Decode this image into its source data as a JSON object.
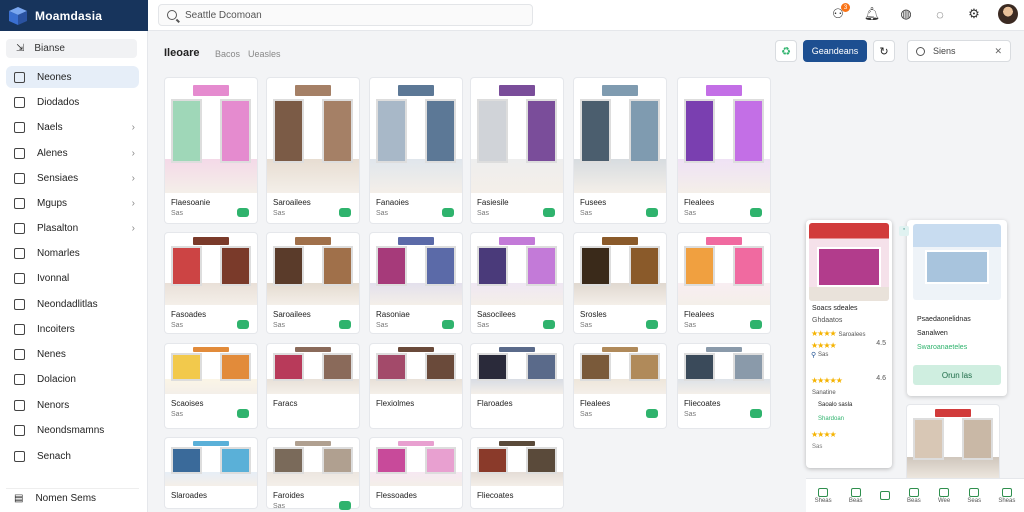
{
  "brand": {
    "name": "Moamdasia"
  },
  "search": {
    "placeholder": "Seattle Dcomoan"
  },
  "header": {
    "badge_count": "3"
  },
  "sidebar": {
    "head": "Bianse",
    "items": [
      {
        "label": "Neones",
        "chev": false
      },
      {
        "label": "Diodados",
        "chev": false
      },
      {
        "label": "Naels",
        "chev": true
      },
      {
        "label": "Alenes",
        "chev": true
      },
      {
        "label": "Sensiaes",
        "chev": true
      },
      {
        "label": "Mgups",
        "chev": true
      },
      {
        "label": "Plasalton",
        "chev": true
      },
      {
        "label": "Nomarles",
        "chev": false
      },
      {
        "label": "Ivonnal",
        "chev": false
      },
      {
        "label": "Neondadlitlas",
        "chev": false
      },
      {
        "label": "Incoiters",
        "chev": false
      },
      {
        "label": "Nenes",
        "chev": false
      },
      {
        "label": "Dolacion",
        "chev": false
      },
      {
        "label": "Nenors",
        "chev": false
      },
      {
        "label": "Neondsmamns",
        "chev": false
      },
      {
        "label": "Senach",
        "chev": false
      }
    ],
    "footer": "Nomen Sems"
  },
  "main": {
    "title": "Ileoare",
    "crumbs": [
      "Bacos",
      "Ueasles"
    ],
    "primary_button": "Geandeans",
    "right_search": "Siens"
  },
  "cards": [
    {
      "title": "Flaesoanie",
      "sub": "Sas"
    },
    {
      "title": "Saroailees",
      "sub": "Sas"
    },
    {
      "title": "Fanaoies",
      "sub": "Sas"
    },
    {
      "title": "Fasiesile",
      "sub": "Sas"
    },
    {
      "title": "Fusees",
      "sub": "Sas"
    },
    {
      "title": "Flealees",
      "sub": "Sas"
    },
    {
      "title": "Fasoades",
      "sub": "Sas"
    },
    {
      "title": "Saroailees",
      "sub": "Sas"
    },
    {
      "title": "Rasoniae",
      "sub": "Sas"
    },
    {
      "title": "Sasocilees",
      "sub": "Sas"
    },
    {
      "title": "Srosles",
      "sub": "Sas"
    },
    {
      "title": "Flealees",
      "sub": "Sas"
    },
    {
      "title": "Scaoises",
      "sub": "Sas"
    },
    {
      "title": "Faracs",
      "sub": ""
    },
    {
      "title": "Flexiolmes",
      "sub": ""
    },
    {
      "title": "Flaroades",
      "sub": ""
    },
    {
      "title": "Flealees",
      "sub": "Sas"
    },
    {
      "title": "Fliecoates",
      "sub": "Sas"
    },
    {
      "title": "Slaroades",
      "sub": ""
    },
    {
      "title": "Faroides",
      "sub": "Sas"
    },
    {
      "title": "Flessoades",
      "sub": ""
    },
    {
      "title": "Fliecoates",
      "sub": ""
    }
  ],
  "panel": {
    "lines": [
      "Soacs sdeales",
      "Ghdaatos",
      "Saroalees",
      "Sas"
    ],
    "rating1": "4.5",
    "rating2": "4.6",
    "count1": "Sas",
    "extra": [
      "Sanatine",
      "Saoalo sasla",
      "Shardoan",
      "Sas"
    ]
  },
  "panel2": {
    "lines": [
      "Psaedaonelidnas",
      "Sanalwen",
      "Swaroanaeteles"
    ],
    "button": "Orun las"
  },
  "bottombar": [
    "Sheas",
    "Beas",
    "",
    "Beas",
    "Wee",
    "Seas",
    "Sheas"
  ]
}
